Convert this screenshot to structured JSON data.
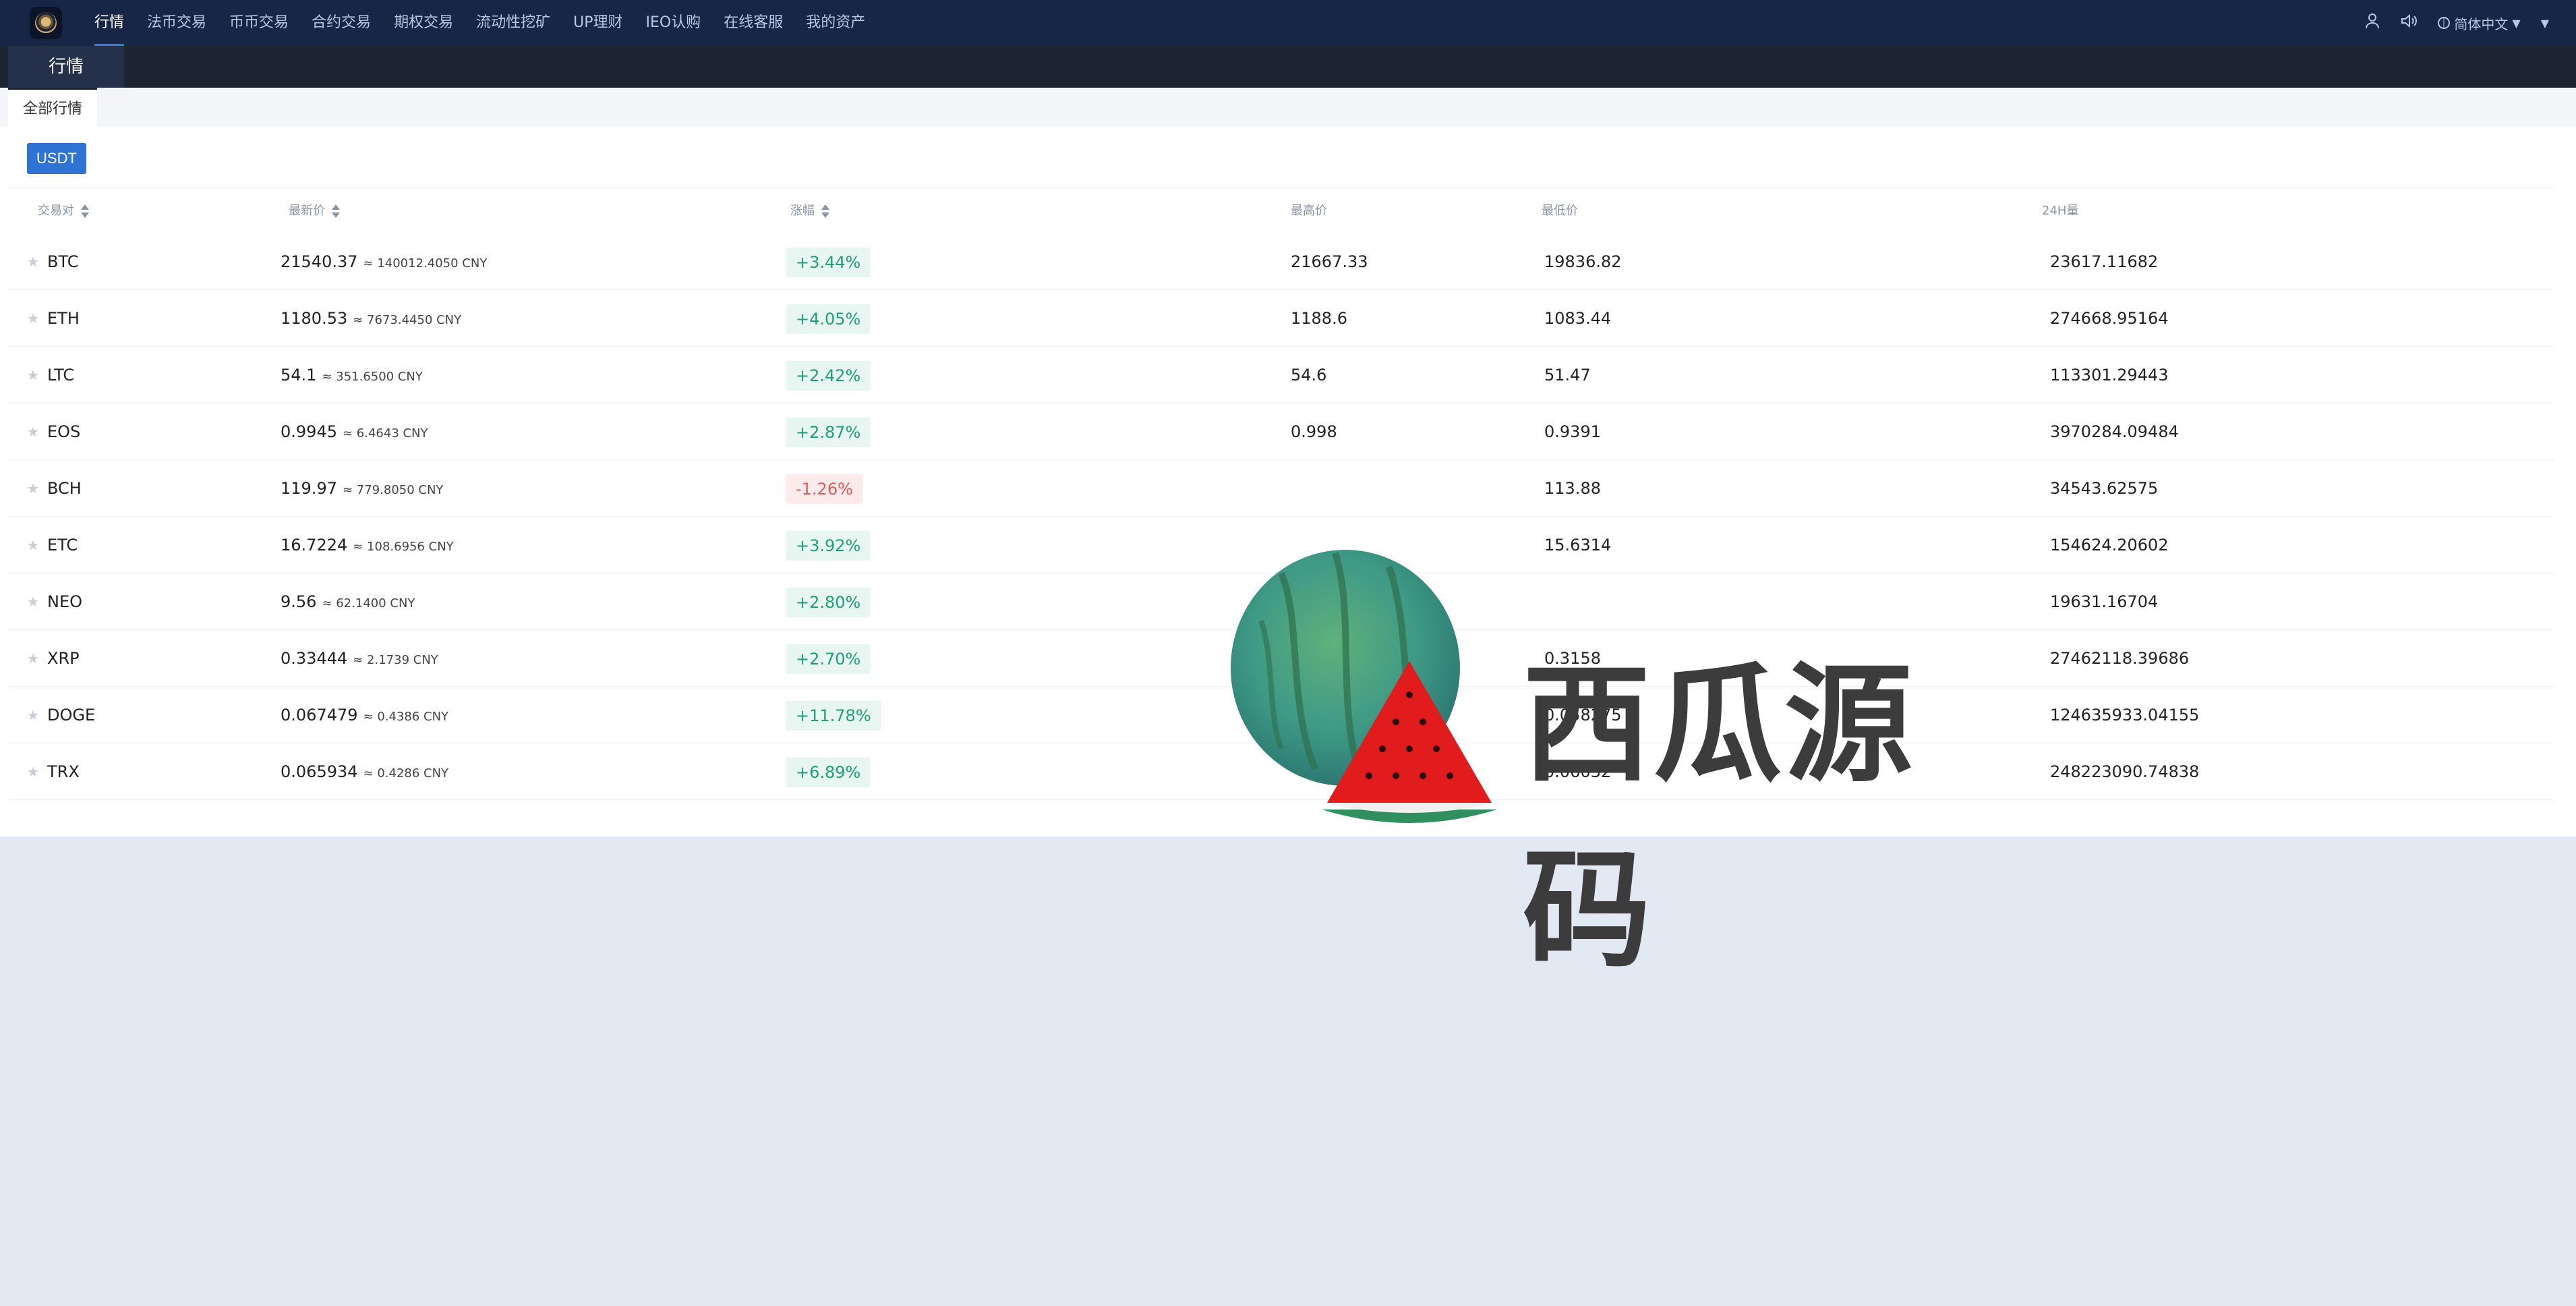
{
  "topbar": {
    "nav": [
      "行情",
      "法币交易",
      "币币交易",
      "合约交易",
      "期权交易",
      "流动性挖矿",
      "UP理财",
      "IEO认购",
      "在线客服",
      "我的资产"
    ],
    "active_index": 0,
    "language": "简体中文",
    "icons": [
      "user-icon",
      "volume-icon",
      "globe-icon",
      "chevron-down-icon"
    ]
  },
  "subbar": {
    "title": "行情"
  },
  "tabs": {
    "active": "全部行情"
  },
  "quote_button": "USDT",
  "table": {
    "headers": [
      "交易对",
      "最新价",
      "涨幅",
      "最高价",
      "最低价",
      "24H量"
    ],
    "rows": [
      {
        "coin": "BTC",
        "price": "21540.37",
        "cny": "≈ 140012.4050 CNY",
        "change": "+3.44%",
        "dir": "up",
        "high": "21667.33",
        "low": "19836.82",
        "vol": "23617.11682"
      },
      {
        "coin": "ETH",
        "price": "1180.53",
        "cny": "≈ 7673.4450 CNY",
        "change": "+4.05%",
        "dir": "up",
        "high": "1188.6",
        "low": "1083.44",
        "vol": "274668.95164"
      },
      {
        "coin": "LTC",
        "price": "54.1",
        "cny": "≈ 351.6500 CNY",
        "change": "+2.42%",
        "dir": "up",
        "high": "54.6",
        "low": "51.47",
        "vol": "113301.29443"
      },
      {
        "coin": "EOS",
        "price": "0.9945",
        "cny": "≈ 6.4643 CNY",
        "change": "+2.87%",
        "dir": "up",
        "high": "0.998",
        "low": "0.9391",
        "vol": "3970284.09484"
      },
      {
        "coin": "BCH",
        "price": "119.97",
        "cny": "≈ 779.8050 CNY",
        "change": "-1.26%",
        "dir": "down",
        "high": "",
        "low": "113.88",
        "vol": "34543.62575"
      },
      {
        "coin": "ETC",
        "price": "16.7224",
        "cny": "≈ 108.6956 CNY",
        "change": "+3.92%",
        "dir": "up",
        "high": "",
        "low": "15.6314",
        "vol": "154624.20602"
      },
      {
        "coin": "NEO",
        "price": "9.56",
        "cny": "≈ 62.1400 CNY",
        "change": "+2.80%",
        "dir": "up",
        "high": "",
        "low": "",
        "vol": "19631.16704"
      },
      {
        "coin": "XRP",
        "price": "0.33444",
        "cny": "≈ 2.1739 CNY",
        "change": "+2.70%",
        "dir": "up",
        "high": "",
        "low": "0.3158",
        "vol": "27462118.39686"
      },
      {
        "coin": "DOGE",
        "price": "0.067479",
        "cny": "≈ 0.4386 CNY",
        "change": "+11.78%",
        "dir": "up",
        "high": "",
        "low": "0.058275",
        "vol": "124635933.04155"
      },
      {
        "coin": "TRX",
        "price": "0.065934",
        "cny": "≈ 0.4286 CNY",
        "change": "+6.89%",
        "dir": "up",
        "high": "",
        "low": "0.06032",
        "vol": "248223090.74838"
      }
    ]
  },
  "watermark": {
    "text": "西瓜源码",
    "icon": "watermelon-icon"
  },
  "colors": {
    "topbar": "#172647",
    "accent": "#2f74d5",
    "up": "#1f9f77",
    "down": "#e05a5a"
  }
}
